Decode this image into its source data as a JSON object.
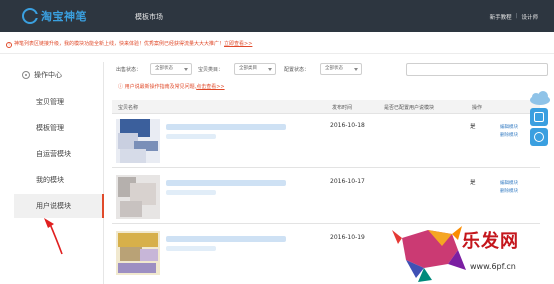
{
  "app": {
    "logo_text": "淘宝神笔",
    "section_title": "模板市场"
  },
  "header_links": {
    "guide": "新手教程",
    "separator": "|",
    "designer": "设计师"
  },
  "notice": {
    "text": "神笔列表区链接升级，我的模块功能全新上线，快来体验！优秀案例已经获得流量大大大推广！",
    "link_label": "立即查看>>"
  },
  "sidebar": {
    "title": "操作中心",
    "items": [
      {
        "label": "宝贝管理"
      },
      {
        "label": "模板管理"
      },
      {
        "label": "自运营模块"
      },
      {
        "label": "我的模块"
      },
      {
        "label": "用户说模块"
      }
    ]
  },
  "filters": {
    "status_label": "出售状态：",
    "status_value": "全部状态",
    "type_label": "状态：",
    "type_value": "全部状态",
    "category_label": "宝贝类目：",
    "category_value": "全部类目",
    "config_label": "配置状态：",
    "config_value": "全部状态",
    "search_placeholder": ""
  },
  "tip": {
    "text": "用户说最新操作指南及常见问题,",
    "link_label": "点击查看>>"
  },
  "table": {
    "headers": [
      "宝贝名称",
      "发布时间",
      "是否已配置用户说模块",
      "操作"
    ],
    "rows": [
      {
        "date": "2016-10-18",
        "configured": "是",
        "actions": [
          "编辑模块",
          "删除模块"
        ]
      },
      {
        "date": "2016-10-17",
        "configured": "是",
        "actions": [
          "编辑模块",
          "删除模块"
        ]
      },
      {
        "date": "2016-10-19",
        "configured": "",
        "actions": []
      }
    ]
  },
  "watermark": {
    "brand": "乐发网",
    "url": "www.6pf.cn"
  },
  "colors": {
    "nav_bg": "#2d3640",
    "accent": "#3aa0e0",
    "alert": "#e04a2a",
    "link": "#3a7fc4"
  }
}
